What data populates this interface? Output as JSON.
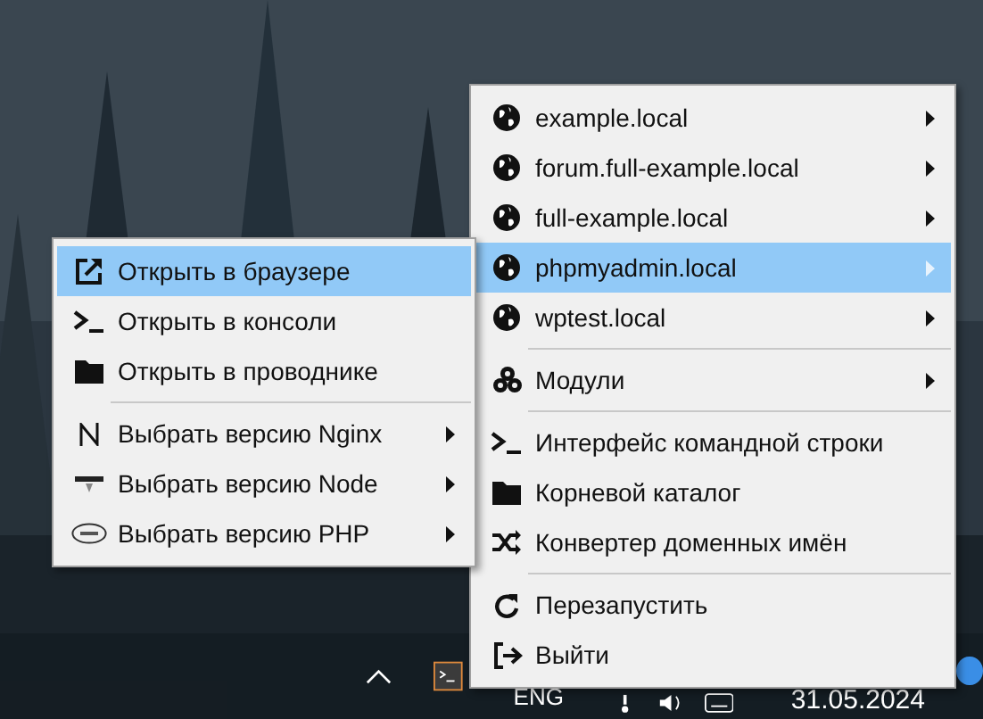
{
  "main_menu": {
    "items": [
      {
        "kind": "item",
        "label": "example.local",
        "selected": false,
        "submenu": true
      },
      {
        "kind": "item",
        "label": "forum.full-example.local",
        "selected": false,
        "submenu": true
      },
      {
        "kind": "item",
        "label": "full-example.local",
        "selected": false,
        "submenu": true
      },
      {
        "kind": "item",
        "label": "phpmyadmin.local",
        "selected": true,
        "submenu": true
      },
      {
        "kind": "item",
        "label": "wptest.local",
        "selected": false,
        "submenu": true
      },
      {
        "kind": "separator"
      },
      {
        "kind": "item",
        "label": "Модули",
        "selected": false,
        "submenu": true
      },
      {
        "kind": "separator"
      },
      {
        "kind": "item",
        "label": "Интерфейс командной строки",
        "selected": false,
        "submenu": false
      },
      {
        "kind": "item",
        "label": "Корневой каталог",
        "selected": false,
        "submenu": false
      },
      {
        "kind": "item",
        "label": "Конвертер доменных имён",
        "selected": false,
        "submenu": false
      },
      {
        "kind": "separator"
      },
      {
        "kind": "item",
        "label": "Перезапустить",
        "selected": false,
        "submenu": false
      },
      {
        "kind": "item",
        "label": "Выйти",
        "selected": false,
        "submenu": false
      }
    ]
  },
  "submenu": {
    "items": [
      {
        "kind": "item",
        "label": "Открыть в браузере",
        "selected": true,
        "submenu": false
      },
      {
        "kind": "item",
        "label": "Открыть в консоли",
        "selected": false,
        "submenu": false
      },
      {
        "kind": "item",
        "label": "Открыть в проводнике",
        "selected": false,
        "submenu": false
      },
      {
        "kind": "separator"
      },
      {
        "kind": "item",
        "label": "Выбрать версию Nginx",
        "selected": false,
        "submenu": true
      },
      {
        "kind": "item",
        "label": "Выбрать версию Node",
        "selected": false,
        "submenu": true
      },
      {
        "kind": "item",
        "label": "Выбрать версию PHP",
        "selected": false,
        "submenu": true
      }
    ]
  },
  "taskbar": {
    "language": "ENG",
    "date": "31.05.2024"
  }
}
